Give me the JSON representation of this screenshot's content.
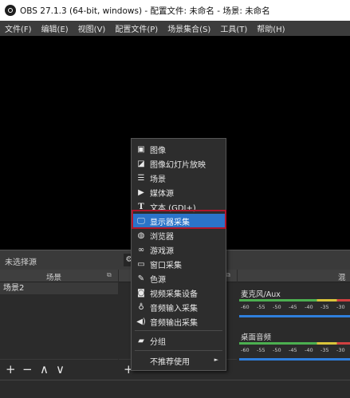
{
  "window": {
    "title": "OBS 27.1.3 (64-bit, windows) - 配置文件: 未命名 - 场景: 未命名"
  },
  "menubar": {
    "items": [
      "文件(F)",
      "编辑(E)",
      "视图(V)",
      "配置文件(P)",
      "场景集合(S)",
      "工具(T)",
      "帮助(H)"
    ]
  },
  "source_toolbar": {
    "label": "未选择源"
  },
  "scenes_dock": {
    "title": "场景",
    "items": [
      "场景2"
    ],
    "footer": [
      "+",
      "−",
      "∧",
      "∨"
    ]
  },
  "sources_dock": {
    "footer": [
      "+"
    ]
  },
  "mixer_dock": {
    "title": "混音",
    "channels": [
      {
        "name": "麦克风/Aux",
        "ticks": [
          "-60",
          "-55",
          "-50",
          "-45",
          "-40",
          "-35",
          "-30"
        ]
      },
      {
        "name": "桌面音频",
        "ticks": [
          "-60",
          "-55",
          "-50",
          "-45",
          "-40",
          "-35",
          "-30"
        ]
      }
    ]
  },
  "context_menu": {
    "items": [
      {
        "label": "图像",
        "icon": "image-icon"
      },
      {
        "label": "图像幻灯片放映",
        "icon": "slideshow-icon"
      },
      {
        "label": "场景",
        "icon": "scene-list-icon"
      },
      {
        "label": "媒体源",
        "icon": "play-icon"
      },
      {
        "label": "文本 (GDI+)",
        "icon": "text-icon"
      },
      {
        "label": "显示器采集",
        "icon": "monitor-icon",
        "selected": true
      },
      {
        "label": "浏览器",
        "icon": "globe-icon"
      },
      {
        "label": "游戏源",
        "icon": "gamepad-icon"
      },
      {
        "label": "窗口采集",
        "icon": "window-icon"
      },
      {
        "label": "色源",
        "icon": "brush-icon"
      },
      {
        "label": "视频采集设备",
        "icon": "camera-icon"
      },
      {
        "label": "音频输入采集",
        "icon": "microphone-icon"
      },
      {
        "label": "音频输出采集",
        "icon": "speaker-icon"
      },
      {
        "label": "分组",
        "icon": "folder-icon"
      },
      {
        "label": "不推荐使用",
        "icon": "",
        "submenu": true
      }
    ],
    "accent": "#2b74c9",
    "highlight_border": "#b0162b"
  }
}
